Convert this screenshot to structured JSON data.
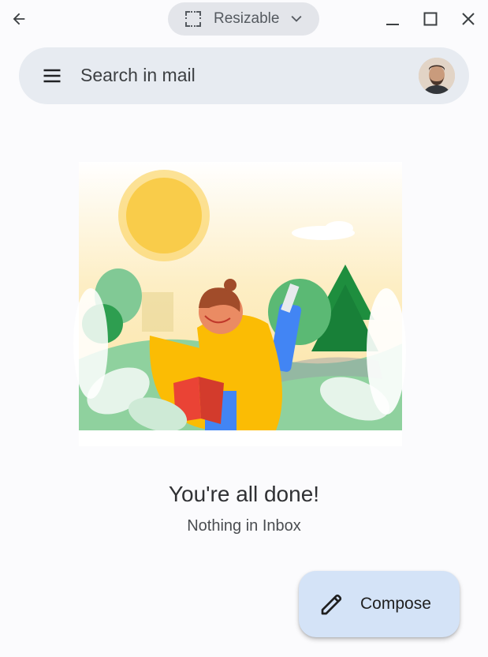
{
  "window": {
    "mode_label": "Resizable",
    "icons": [
      "back-arrow-icon",
      "resize-icon",
      "chevron-down-icon",
      "minimize-icon",
      "maximize-icon",
      "close-icon"
    ]
  },
  "search": {
    "placeholder": "Search in mail",
    "menu_icon": "hamburger-menu-icon",
    "avatar": "account-avatar"
  },
  "empty_state": {
    "title": "You're all done!",
    "subtitle": "Nothing in Inbox",
    "illustration": "person-reading-in-garden"
  },
  "compose": {
    "label": "Compose",
    "icon": "pencil-icon"
  },
  "colors": {
    "background": "#fbfbfd",
    "search_bar": "#e7ebf1",
    "compose_fab": "#d4e3f7",
    "pill": "#e3e5ea"
  }
}
